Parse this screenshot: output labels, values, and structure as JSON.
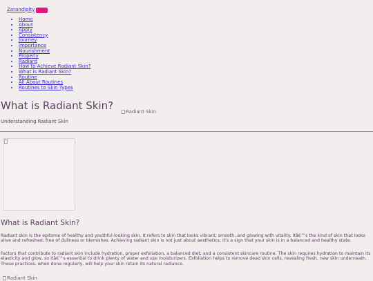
{
  "header": {
    "logo": "Zarandipity"
  },
  "nav": {
    "items": [
      "Home",
      "About",
      "Apply",
      "Consistency",
      "Journey",
      "Importance",
      "Nourishment",
      "Properly",
      "Radiant",
      "How to Achieve Radiant Skin?",
      "What is Radiant Skin?",
      "Routine",
      "All About Routines",
      "Routines to Skin Types"
    ]
  },
  "hero": {
    "title": "What is Radiant Skin?",
    "image_alt": "Radiant Skin",
    "subtitle": "Understanding Radiant Skin"
  },
  "section": {
    "title": "What is Radiant Skin?",
    "paragraph1": "Radiant skin is the epitome of healthy and youthful-looking skin. It refers to skin that looks vibrant, smooth, and glowing with vitality. Itâ€™s the kind of skin that looks alive and refreshed, free of dullness or blemishes. Achieving radiant skin is not just about aesthetics; it's a sign that your skin is in a balanced and healthy state.",
    "paragraph2": "Factors that contribute to radiant skin include hydration, proper exfoliation, a balanced diet, and a consistent skincare routine. The skin requires hydration to maintain its elasticity and glow, so itâ€™s essential to drink plenty of water and use moisturizers. Exfoliation helps to remove dead skin cells, revealing fresh, new skin underneath. These practices, when done regularly, will help your skin retain its natural radiance.",
    "bottom_image_alt": "Radiant Skin"
  },
  "colors": {
    "accent": "#e0187a",
    "link": "#3a2ad0",
    "text": "#5c3f60",
    "background": "#f3eeee"
  }
}
